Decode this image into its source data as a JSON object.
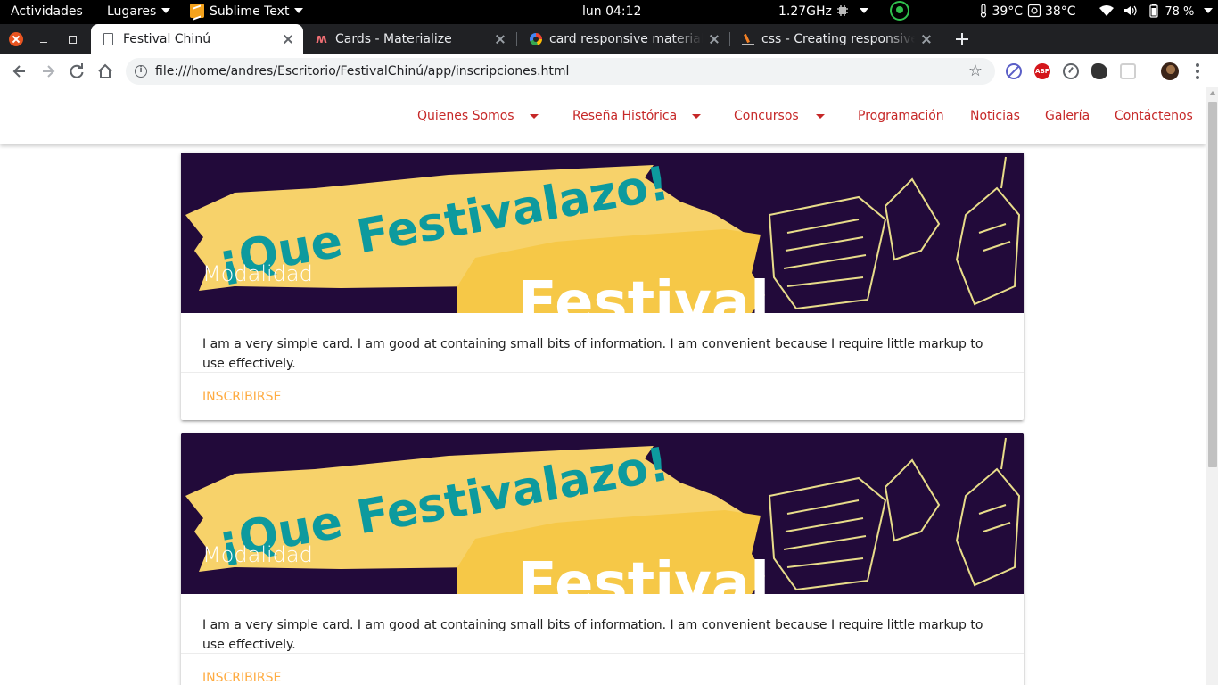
{
  "system_bar": {
    "activities": "Actividades",
    "places": "Lugares",
    "app_name": "Sublime Text",
    "clock": "lun 04:12",
    "cpu_freq": "1.27GHz",
    "temp_cpu": "39°C",
    "temp_other": "38°C",
    "battery": "78 %"
  },
  "tabs": [
    {
      "title": "Festival Chinú",
      "active": true
    },
    {
      "title": "Cards - Materialize",
      "active": false
    },
    {
      "title": "card responsive materialize",
      "active": false
    },
    {
      "title": "css - Creating responsive card",
      "active": false
    }
  ],
  "address_bar": {
    "url": "file:///home/andres/Escritorio/FestivalChinú/app/inscripciones.html"
  },
  "site_nav": {
    "items": [
      {
        "label": "Quienes Somos",
        "dropdown": true
      },
      {
        "label": "Reseña Histórica",
        "dropdown": true
      },
      {
        "label": "Concursos",
        "dropdown": true
      },
      {
        "label": "Programación",
        "dropdown": false
      },
      {
        "label": "Noticias",
        "dropdown": false
      },
      {
        "label": "Galería",
        "dropdown": false
      },
      {
        "label": "Contáctenos",
        "dropdown": false
      }
    ],
    "link_color": "#c62828"
  },
  "cards": [
    {
      "title": "Modalidad",
      "banner_text": "¡Que Festivalazo!",
      "banner_subtext": "Festival",
      "content": "I am a very simple card. I am good at containing small bits of information. I am convenient because I require little markup to use effectively.",
      "action": "INSCRIBIRSE"
    },
    {
      "title": "Modalidad",
      "banner_text": "¡Que Festivalazo!",
      "banner_subtext": "Festival",
      "content": "I am a very simple card. I am good at containing small bits of information. I am convenient because I require little markup to use effectively.",
      "action": "INSCRIBIRSE"
    }
  ],
  "colors": {
    "accent_action": "#ffab40",
    "banner_bg": "#220a3a",
    "banner_yellow": "#f7d26a",
    "banner_teal": "#0d9a9e"
  }
}
